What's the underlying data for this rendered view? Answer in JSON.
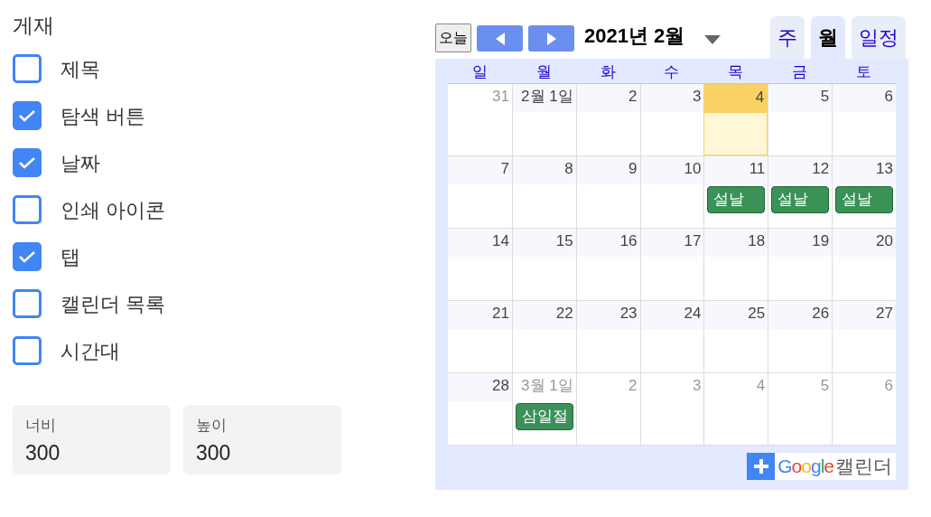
{
  "display": {
    "title": "게재",
    "options": [
      {
        "label": "제목",
        "checked": false
      },
      {
        "label": "탐색 버튼",
        "checked": true
      },
      {
        "label": "날짜",
        "checked": true
      },
      {
        "label": "인쇄 아이콘",
        "checked": false
      },
      {
        "label": "탭",
        "checked": true
      },
      {
        "label": "캘린더 목록",
        "checked": false
      },
      {
        "label": "시간대",
        "checked": false
      }
    ]
  },
  "size_fields": [
    {
      "label": "너비",
      "value": "300"
    },
    {
      "label": "높이",
      "value": "300"
    }
  ],
  "calendar": {
    "today_button": "오늘",
    "month_title": "2021년 2월",
    "view_tabs": [
      {
        "label": "주",
        "selected": false
      },
      {
        "label": "월",
        "selected": true
      },
      {
        "label": "일정",
        "selected": false
      }
    ],
    "weekdays": [
      "일",
      "월",
      "화",
      "수",
      "목",
      "금",
      "토"
    ],
    "weeks": [
      [
        {
          "label": "31",
          "other_month": true,
          "today": false
        },
        {
          "label": "2월 1일",
          "other_month": false,
          "today": false
        },
        {
          "label": "2",
          "other_month": false,
          "today": false
        },
        {
          "label": "3",
          "other_month": false,
          "today": false
        },
        {
          "label": "4",
          "other_month": false,
          "today": true
        },
        {
          "label": "5",
          "other_month": false,
          "today": false
        },
        {
          "label": "6",
          "other_month": false,
          "today": false
        }
      ],
      [
        {
          "label": "7",
          "other_month": false,
          "today": false
        },
        {
          "label": "8",
          "other_month": false,
          "today": false
        },
        {
          "label": "9",
          "other_month": false,
          "today": false
        },
        {
          "label": "10",
          "other_month": false,
          "today": false
        },
        {
          "label": "11",
          "other_month": false,
          "today": false,
          "events": [
            {
              "title": "설날",
              "color": "#3b9157"
            }
          ]
        },
        {
          "label": "12",
          "other_month": false,
          "today": false,
          "events": [
            {
              "title": "설날",
              "color": "#3b9157"
            }
          ]
        },
        {
          "label": "13",
          "other_month": false,
          "today": false,
          "events": [
            {
              "title": "설날",
              "color": "#3b9157"
            }
          ]
        }
      ],
      [
        {
          "label": "14",
          "other_month": false,
          "today": false
        },
        {
          "label": "15",
          "other_month": false,
          "today": false
        },
        {
          "label": "16",
          "other_month": false,
          "today": false
        },
        {
          "label": "17",
          "other_month": false,
          "today": false
        },
        {
          "label": "18",
          "other_month": false,
          "today": false
        },
        {
          "label": "19",
          "other_month": false,
          "today": false
        },
        {
          "label": "20",
          "other_month": false,
          "today": false
        }
      ],
      [
        {
          "label": "21",
          "other_month": false,
          "today": false
        },
        {
          "label": "22",
          "other_month": false,
          "today": false
        },
        {
          "label": "23",
          "other_month": false,
          "today": false
        },
        {
          "label": "24",
          "other_month": false,
          "today": false
        },
        {
          "label": "25",
          "other_month": false,
          "today": false
        },
        {
          "label": "26",
          "other_month": false,
          "today": false
        },
        {
          "label": "27",
          "other_month": false,
          "today": false
        }
      ],
      [
        {
          "label": "28",
          "other_month": false,
          "today": false
        },
        {
          "label": "3월 1일",
          "other_month": true,
          "today": false,
          "events": [
            {
              "title": "삼일절",
              "color": "#3b9157"
            }
          ]
        },
        {
          "label": "2",
          "other_month": true,
          "today": false
        },
        {
          "label": "3",
          "other_month": true,
          "today": false
        },
        {
          "label": "4",
          "other_month": true,
          "today": false
        },
        {
          "label": "5",
          "other_month": true,
          "today": false
        },
        {
          "label": "6",
          "other_month": true,
          "today": false
        }
      ]
    ],
    "footer": {
      "logo": "Google",
      "label": "캘린더"
    }
  }
}
